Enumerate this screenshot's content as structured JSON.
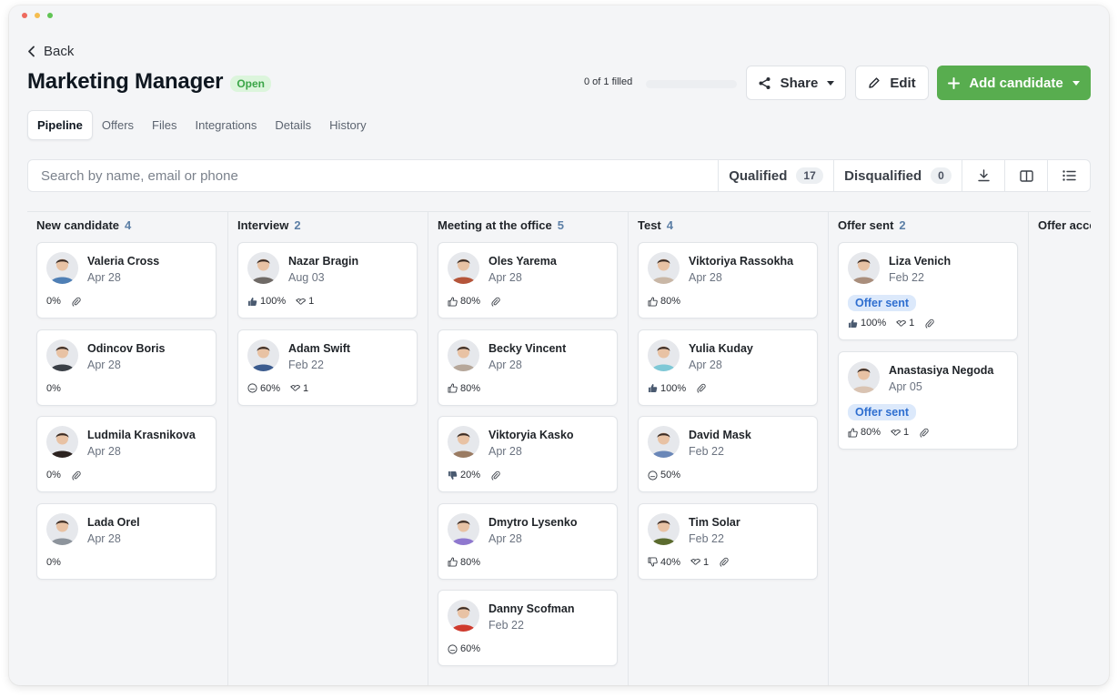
{
  "window": {
    "dot_colors": [
      "#ee6a5e",
      "#f5bd4f",
      "#61c454"
    ]
  },
  "nav": {
    "back_label": "Back"
  },
  "job": {
    "title": "Marketing Manager",
    "status": "Open",
    "filled_text": "0 of 1 filled",
    "filled_fraction": 0
  },
  "actions": {
    "share_label": "Share",
    "edit_label": "Edit",
    "add_label": "Add candidate"
  },
  "tabs": [
    "Pipeline",
    "Offers",
    "Files",
    "Integrations",
    "Details",
    "History"
  ],
  "search": {
    "placeholder": "Search by name, email or phone"
  },
  "filters": {
    "qualified_label": "Qualified",
    "qualified_count": "17",
    "disqualified_label": "Disqualified",
    "disqualified_count": "0"
  },
  "colors": {
    "accent_green": "#58ad4f",
    "badge_blue_bg": "#dce9fb",
    "badge_blue_text": "#2f6fd0",
    "open_badge_bg": "#dcf5dc",
    "open_badge_text": "#3aa547"
  },
  "columns": [
    {
      "name": "New candidate",
      "count": "4",
      "cards": [
        {
          "name": "Valeria Cross",
          "date": "Apr 28",
          "score": "0%",
          "score_icon": "none",
          "attachment": true,
          "tone": "#4f7fb5"
        },
        {
          "name": "Odincov Boris",
          "date": "Apr 28",
          "score": "0%",
          "score_icon": "none",
          "tone": "#3a3f46"
        },
        {
          "name": "Ludmila Krasnikova",
          "date": "Apr 28",
          "score": "0%",
          "score_icon": "none",
          "attachment": true,
          "tone": "#2c2320"
        },
        {
          "name": "Lada Orel",
          "date": "Apr 28",
          "score": "0%",
          "score_icon": "none",
          "tone": "#8d949c"
        }
      ]
    },
    {
      "name": "Interview",
      "count": "2",
      "cards": [
        {
          "name": "Nazar Bragin",
          "date": "Aug 03",
          "score": "100%",
          "score_icon": "thumb-up-filled",
          "interviews": "1",
          "tone": "#6f6a66"
        },
        {
          "name": "Adam Swift",
          "date": "Feb 22",
          "score": "60%",
          "score_icon": "neutral",
          "interviews": "1",
          "tone": "#3b5b8e"
        }
      ]
    },
    {
      "name": "Meeting at the office",
      "count": "5",
      "cards": [
        {
          "name": "Oles Yarema",
          "date": "Apr 28",
          "score": "80%",
          "score_icon": "thumb-up",
          "attachment": true,
          "tone": "#b5553a"
        },
        {
          "name": "Becky Vincent",
          "date": "Apr 28",
          "score": "80%",
          "score_icon": "thumb-up",
          "tone": "#b6a79a"
        },
        {
          "name": "Viktoryia Kasko",
          "date": "Apr 28",
          "score": "20%",
          "score_icon": "thumb-down-filled",
          "attachment": true,
          "tone": "#9a7b62"
        },
        {
          "name": "Dmytro Lysenko",
          "date": "Apr 28",
          "score": "80%",
          "score_icon": "thumb-up",
          "tone": "#8f78cf"
        },
        {
          "name": "Danny Scofman",
          "date": "Feb 22",
          "score": "60%",
          "score_icon": "neutral",
          "tone": "#cf3b2e"
        }
      ]
    },
    {
      "name": "Test",
      "count": "4",
      "cards": [
        {
          "name": "Viktoriya Rassokha",
          "date": "Apr 28",
          "score": "80%",
          "score_icon": "thumb-up",
          "tone": "#c9b7a6"
        },
        {
          "name": "Yulia Kuday",
          "date": "Apr 28",
          "score": "100%",
          "score_icon": "thumb-up-filled",
          "attachment": true,
          "tone": "#7ec8d6"
        },
        {
          "name": "David Mask",
          "date": "Feb 22",
          "score": "50%",
          "score_icon": "neutral",
          "tone": "#6a87b8"
        },
        {
          "name": "Tim Solar",
          "date": "Feb 22",
          "score": "40%",
          "score_icon": "thumb-down",
          "interviews": "1",
          "attachment": true,
          "tone": "#5b6b2e"
        }
      ]
    },
    {
      "name": "Offer sent",
      "count": "2",
      "cards": [
        {
          "name": "Liza Venich",
          "date": "Feb 22",
          "badge": "Offer sent",
          "score": "100%",
          "score_icon": "thumb-up-filled",
          "interviews": "1",
          "attachment": true,
          "tone": "#a98e7c"
        },
        {
          "name": "Anastasiya Negoda",
          "date": "Apr 05",
          "badge": "Offer sent",
          "score": "80%",
          "score_icon": "thumb-up",
          "interviews": "1",
          "attachment": true,
          "tone": "#d9c3b2"
        }
      ]
    },
    {
      "name": "Offer acce",
      "count": "",
      "cards": []
    }
  ]
}
